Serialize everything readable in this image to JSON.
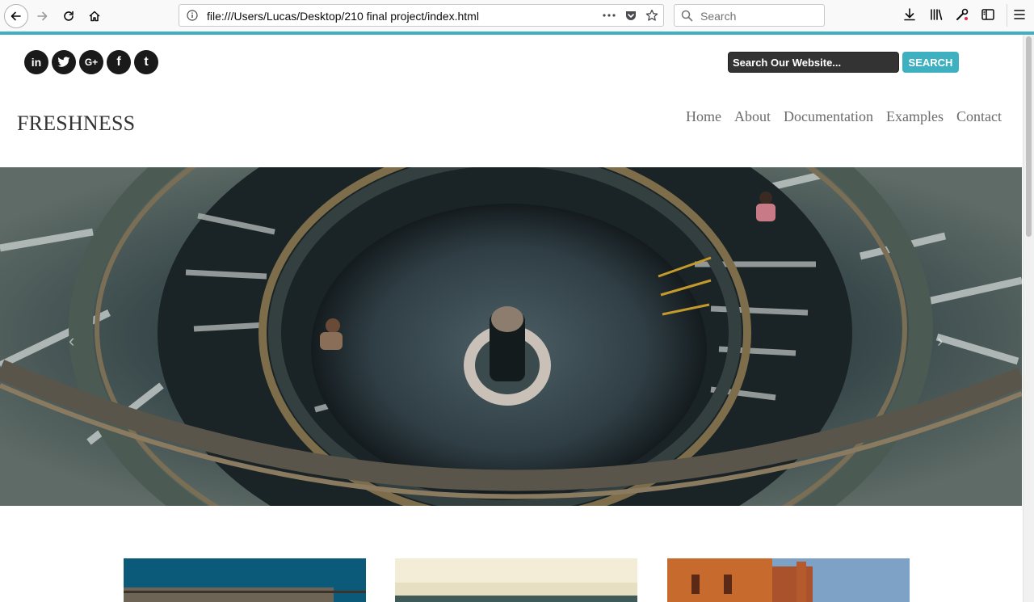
{
  "browser": {
    "url": "file:///Users/Lucas/Desktop/210 final project/index.html",
    "search_placeholder": "Search"
  },
  "page": {
    "social": [
      {
        "label": "in",
        "icon": "linkedin-icon"
      },
      {
        "label": "✦",
        "icon": "twitter-icon"
      },
      {
        "label": "G+",
        "icon": "google-plus-icon"
      },
      {
        "label": "f",
        "icon": "facebook-icon"
      },
      {
        "label": "t",
        "icon": "tumblr-icon"
      }
    ],
    "search_placeholder": "Search Our Website...",
    "search_button": "SEARCH",
    "logo": "FRESHNESS",
    "nav": [
      "Home",
      "About",
      "Documentation",
      "Examples",
      "Contact"
    ],
    "hero_prev": "‹",
    "hero_next": "›"
  },
  "colors": {
    "accent": "#3fb0c0",
    "dark": "#1a1a1a"
  }
}
